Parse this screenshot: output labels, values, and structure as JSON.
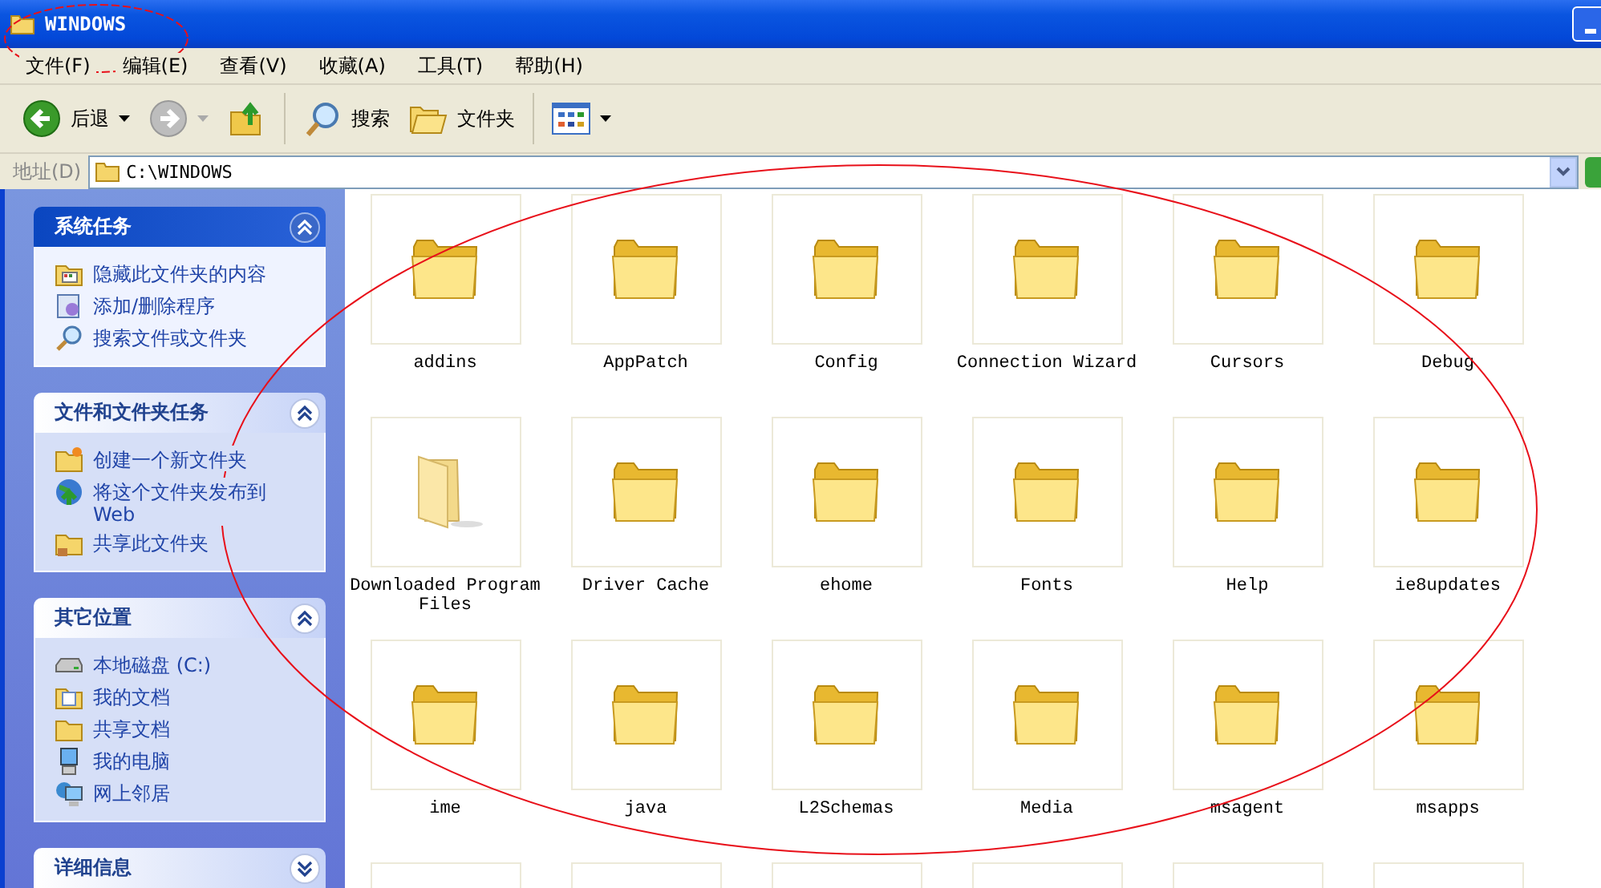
{
  "window": {
    "title": "WINDOWS"
  },
  "menu": [
    {
      "label": "文件(F)"
    },
    {
      "label": "编辑(E)"
    },
    {
      "label": "查看(V)"
    },
    {
      "label": "收藏(A)"
    },
    {
      "label": "工具(T)"
    },
    {
      "label": "帮助(H)"
    }
  ],
  "toolbar": [
    {
      "kind": "back",
      "label": "后退",
      "disabled": false
    },
    {
      "kind": "forward",
      "disabled": true
    },
    {
      "kind": "up"
    },
    {
      "kind": "separator"
    },
    {
      "kind": "search",
      "label": "搜索"
    },
    {
      "kind": "folders",
      "label": "文件夹"
    },
    {
      "kind": "separator"
    },
    {
      "kind": "views"
    }
  ],
  "address": {
    "label": "地址(D)",
    "value": "C:\\WINDOWS"
  },
  "sidebar": [
    {
      "kind": "special",
      "title": "系统任务",
      "expanded": true,
      "items": [
        {
          "kind": "hide",
          "label": "隐藏此文件夹的内容"
        },
        {
          "kind": "programs",
          "label": "添加/删除程序"
        },
        {
          "kind": "search",
          "label": "搜索文件或文件夹"
        }
      ]
    },
    {
      "kind": "normal",
      "title": "文件和文件夹任务",
      "expanded": true,
      "items": [
        {
          "kind": "new-folder",
          "label": "创建一个新文件夹"
        },
        {
          "kind": "globe",
          "label": "将这个文件夹发布到 Web"
        },
        {
          "kind": "share",
          "label": "共享此文件夹"
        }
      ]
    },
    {
      "kind": "normal",
      "title": "其它位置",
      "expanded": true,
      "items": [
        {
          "kind": "drive",
          "label": "本地磁盘 (C:)"
        },
        {
          "kind": "documents",
          "label": "我的文档"
        },
        {
          "kind": "folder",
          "label": "共享文档"
        },
        {
          "kind": "computer",
          "label": "我的电脑"
        },
        {
          "kind": "network",
          "label": "网上邻居"
        }
      ]
    },
    {
      "kind": "normal",
      "title": "详细信息",
      "expanded": false
    }
  ],
  "files": [
    {
      "kind": "folder",
      "name": "addins"
    },
    {
      "kind": "folder",
      "name": "AppPatch"
    },
    {
      "kind": "folder",
      "name": "Config"
    },
    {
      "kind": "folder",
      "name": "Connection Wizard"
    },
    {
      "kind": "folder",
      "name": "Cursors"
    },
    {
      "kind": "folder",
      "name": "Debug"
    },
    {
      "kind": "open-folder",
      "name": "Downloaded Program Files"
    },
    {
      "kind": "folder",
      "name": "Driver Cache"
    },
    {
      "kind": "folder",
      "name": "ehome"
    },
    {
      "kind": "folder",
      "name": "Fonts"
    },
    {
      "kind": "folder",
      "name": "Help"
    },
    {
      "kind": "folder",
      "name": "ie8updates"
    },
    {
      "kind": "folder",
      "name": "ime"
    },
    {
      "kind": "folder",
      "name": "java"
    },
    {
      "kind": "folder",
      "name": "L2Schemas"
    },
    {
      "kind": "folder",
      "name": "Media"
    },
    {
      "kind": "folder",
      "name": "msagent"
    },
    {
      "kind": "folder",
      "name": "msapps"
    }
  ]
}
